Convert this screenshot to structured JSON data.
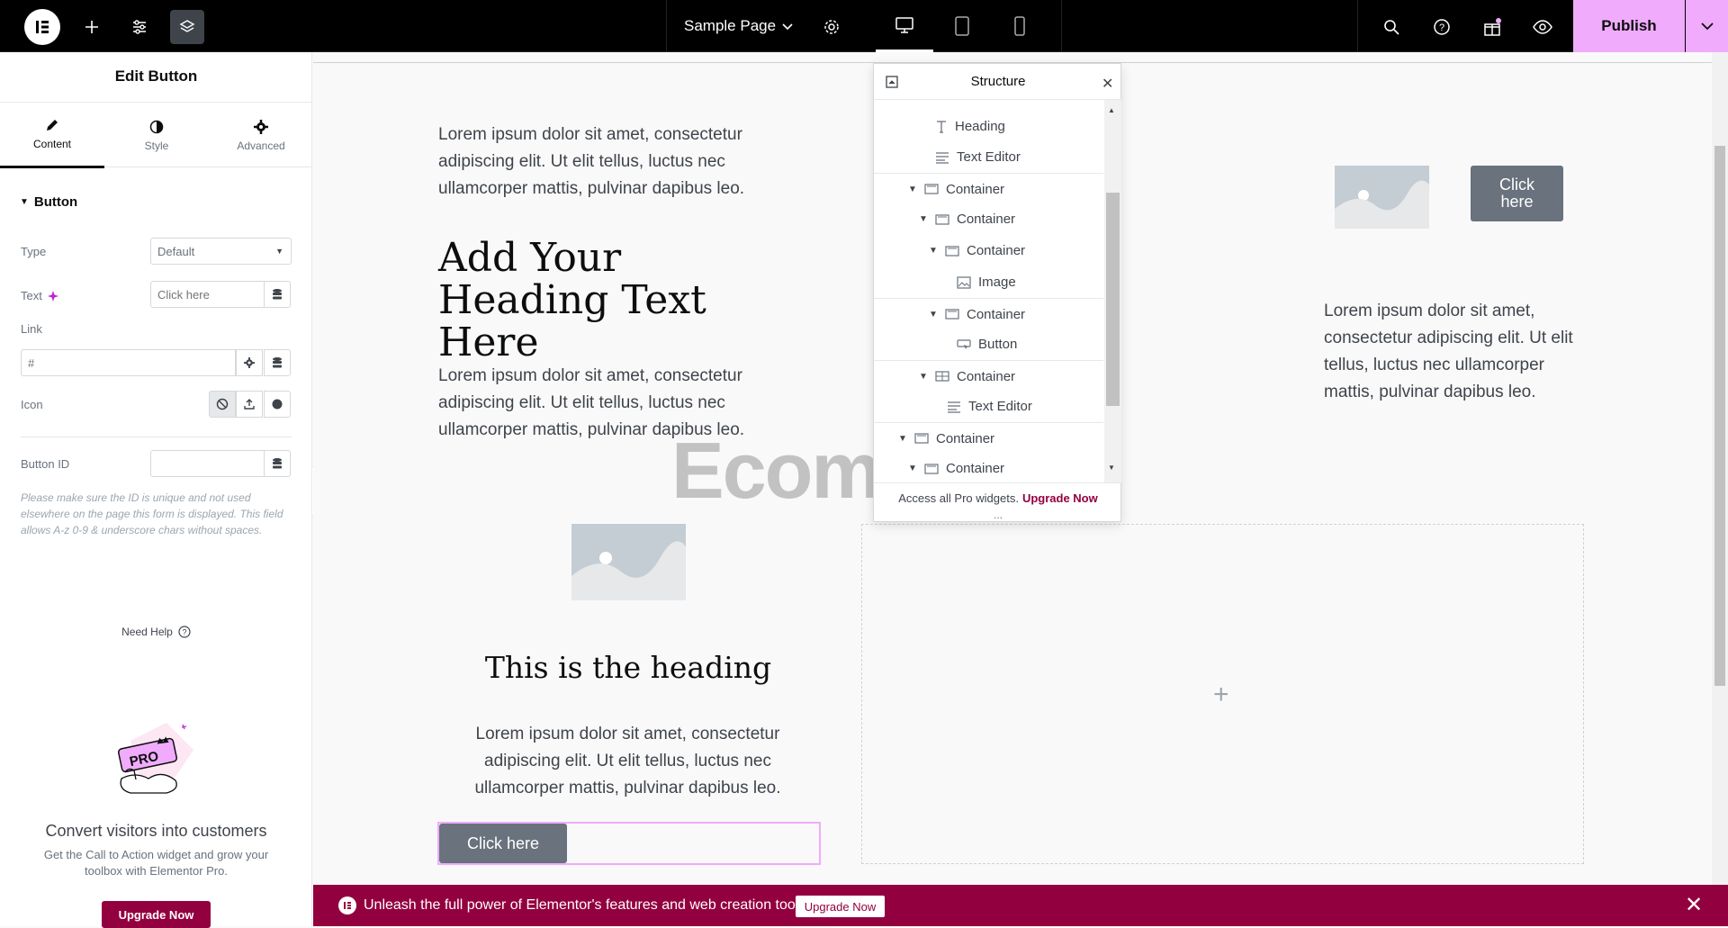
{
  "topbar": {
    "page_title": "Sample Page",
    "publish_label": "Publish",
    "accent_color": "#f0abfc"
  },
  "panel": {
    "title": "Edit Button",
    "tabs": [
      {
        "label": "Content",
        "icon": "pencil-icon"
      },
      {
        "label": "Style",
        "icon": "half-circle-icon"
      },
      {
        "label": "Advanced",
        "icon": "gear-icon"
      }
    ],
    "section": "Button",
    "type_label": "Type",
    "type_value": "Default",
    "text_label": "Text",
    "text_placeholder": "Click here",
    "link_label": "Link",
    "link_placeholder": "#",
    "icon_label": "Icon",
    "button_id_label": "Button ID",
    "help_text": "Please make sure the ID is unique and not used elsewhere on the page this form is displayed. This field allows A-z 0-9 & underscore chars without spaces.",
    "need_help": "Need Help",
    "promo_title": "Convert visitors into customers",
    "promo_desc": "Get the Call to Action widget and grow your toolbox with Elementor Pro.",
    "upgrade_label": "Upgrade Now"
  },
  "canvas": {
    "lorem1": "Lorem ipsum dolor sit amet, consectetur adipiscing elit. Ut elit tellus, luctus nec ullamcorper mattis, pulvinar dapibus leo.",
    "heading1": "Add Your Heading Text Here",
    "lorem2": "Lorem ipsum dolor sit amet, consectetur adipiscing elit. Ut elit tellus, luctus nec ullamcorper mattis, pulvinar dapibus leo.",
    "heading2": "This is the heading",
    "lorem3": "Lorem ipsum dolor sit amet, consectetur adipiscing elit. Ut elit tellus, luctus nec ullamcorper mattis, pulvinar dapibus leo.",
    "button1": "Click here",
    "button2": "Click here",
    "lorem4": "Lorem ipsum dolor sit amet, consectetur adipiscing elit. Ut elit tellus, luctus nec ullamcorper mattis, pulvinar dapibus leo.",
    "watermark": "Ecomools"
  },
  "structure": {
    "title": "Structure",
    "items": [
      {
        "label": "Heading",
        "icon": "heading-icon"
      },
      {
        "label": "Text Editor",
        "icon": "text-editor-icon"
      },
      {
        "label": "Container",
        "icon": "container-icon"
      },
      {
        "label": "Container",
        "icon": "container-icon"
      },
      {
        "label": "Container",
        "icon": "container-icon"
      },
      {
        "label": "Image",
        "icon": "image-icon"
      },
      {
        "label": "Container",
        "icon": "container-icon"
      },
      {
        "label": "Button",
        "icon": "button-icon"
      },
      {
        "label": "Container",
        "icon": "grid-container-icon"
      },
      {
        "label": "Text Editor",
        "icon": "text-editor-icon"
      },
      {
        "label": "Container",
        "icon": "container-icon"
      },
      {
        "label": "Container",
        "icon": "container-icon"
      }
    ],
    "footer_text": "Access all Pro widgets.",
    "footer_link": "Upgrade Now",
    "dots": "..."
  },
  "banner": {
    "text": "Unleash the full power of Elementor's features and web creation tools.",
    "button": "Upgrade Now",
    "color": "#93003f"
  }
}
